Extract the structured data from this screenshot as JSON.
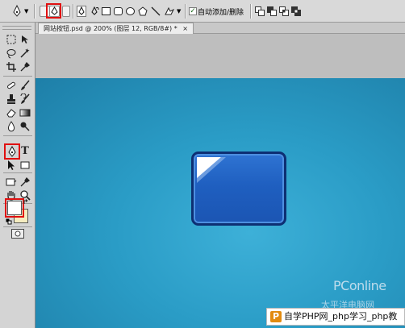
{
  "options_bar": {
    "auto_add_delete_label": "自动添加/删除",
    "auto_add_delete_checked": "✓"
  },
  "toolbox": {
    "type_tool_glyph": "T"
  },
  "document": {
    "tab_title": "网站按钮.psd @ 200% (图层 12, RGB/8#) *",
    "tab_close": "×"
  },
  "watermark": {
    "brand": "PConline",
    "sub": "太平洋电脑网"
  },
  "site_logo": {
    "icon_letter": "P",
    "text": "自学PHP网_php学习_php教"
  },
  "colors": {
    "canvas_blue": "#2a9cc6",
    "button_blue": "#1f5fc0",
    "highlight_red": "#e01010"
  }
}
